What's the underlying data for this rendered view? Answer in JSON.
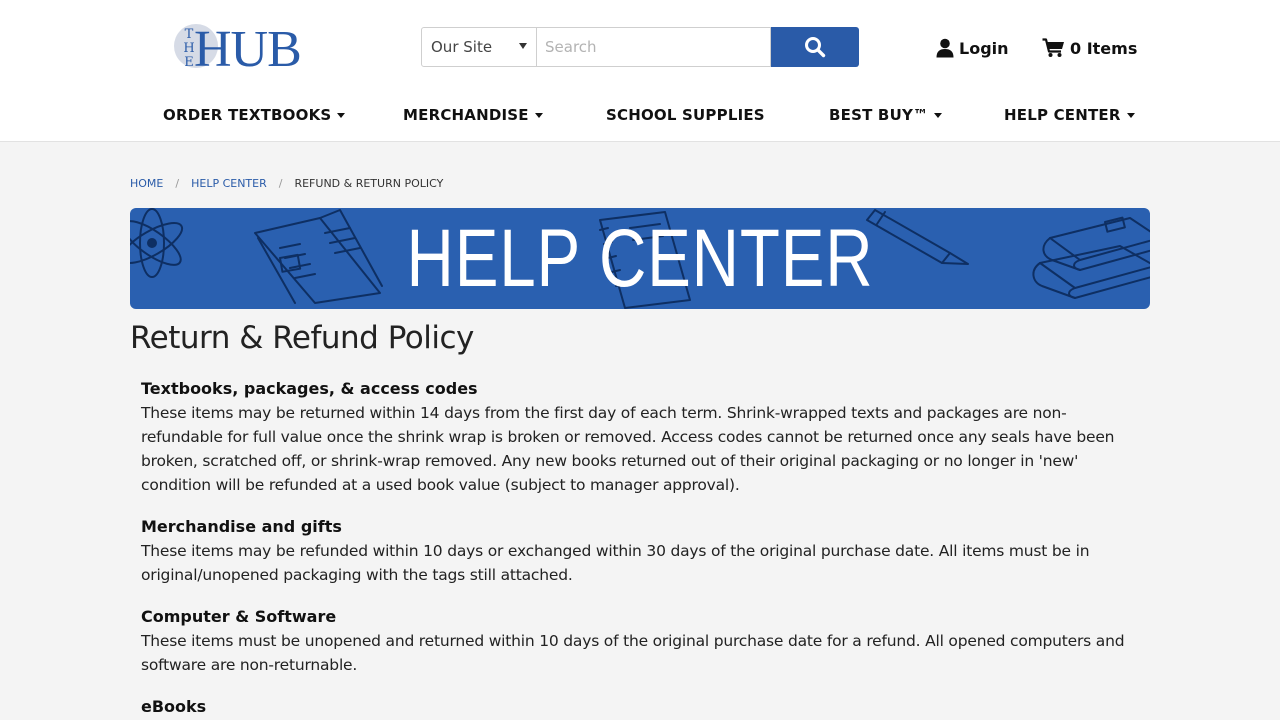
{
  "logo": {
    "small": "THE",
    "big": "HUB"
  },
  "search": {
    "scope": "Our Site",
    "placeholder": "Search"
  },
  "account": {
    "login": "Login",
    "cart": "0 Items"
  },
  "nav": [
    {
      "label": "ORDER TEXTBOOKS",
      "dropdown": true
    },
    {
      "label": "MERCHANDISE",
      "dropdown": true
    },
    {
      "label": "SCHOOL SUPPLIES",
      "dropdown": false
    },
    {
      "label": "BEST BUY™",
      "dropdown": true
    },
    {
      "label": "HELP CENTER",
      "dropdown": true
    }
  ],
  "breadcrumb": {
    "home": "HOME",
    "help": "HELP CENTER",
    "current": "REFUND & RETURN POLICY"
  },
  "banner": {
    "title": "HELP CENTER"
  },
  "page": {
    "title": "Return & Refund Policy",
    "sections": [
      {
        "heading": "Textbooks, packages, & access codes",
        "body": "These items may be returned within 14 days from the first day of each term. Shrink-wrapped texts and packages are non-refundable for full value once the shrink wrap is broken or removed. Access codes cannot be returned once any seals have been broken, scratched off, or shrink-wrap removed. Any new books returned out of their original packaging or no longer in 'new' condition will be refunded at a used book value (subject to manager approval)."
      },
      {
        "heading": "Merchandise and gifts",
        "body": "These items may be refunded within 10 days or exchanged within 30 days of the original purchase date. All items must be in original/unopened packaging with the tags still attached."
      },
      {
        "heading": "Computer & Software",
        "body": "These items must be unopened and returned within 10 days of the original purchase date for a refund. All opened computers and software are non-returnable."
      },
      {
        "heading": "eBooks",
        "body": ""
      }
    ]
  },
  "colors": {
    "brand": "#2a5ba8",
    "banner": "#2a60b0",
    "background": "#f4f4f4"
  },
  "icons": {
    "search": "search-icon",
    "user": "user-icon",
    "cart": "cart-icon"
  }
}
